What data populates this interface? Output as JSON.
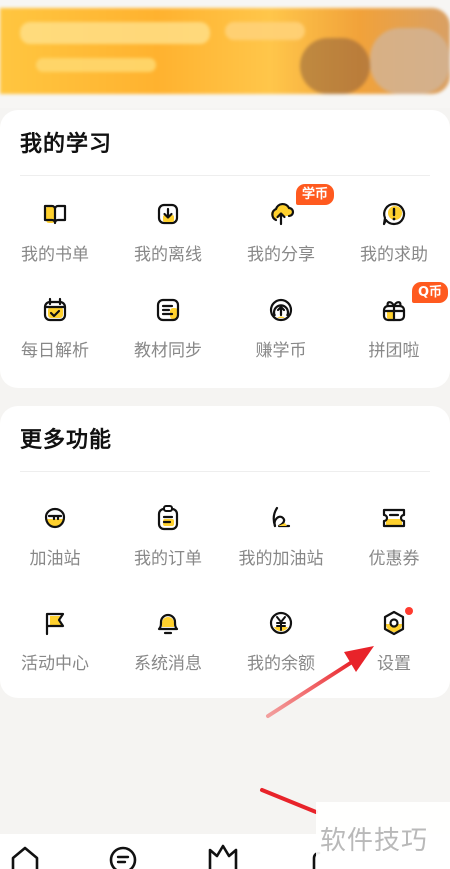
{
  "study": {
    "title": "我的学习",
    "items": [
      {
        "label": "我的书单"
      },
      {
        "label": "我的离线"
      },
      {
        "label": "我的分享",
        "badge": "学币"
      },
      {
        "label": "我的求助"
      },
      {
        "label": "每日解析"
      },
      {
        "label": "教材同步"
      },
      {
        "label": "赚学币"
      },
      {
        "label": "拼团啦",
        "badge": "Q币"
      }
    ]
  },
  "more": {
    "title": "更多功能",
    "items": [
      {
        "label": "加油站"
      },
      {
        "label": "我的订单"
      },
      {
        "label": "我的加油站"
      },
      {
        "label": "优惠券"
      },
      {
        "label": "活动中心"
      },
      {
        "label": "系统消息"
      },
      {
        "label": "我的余额"
      },
      {
        "label": "设置"
      }
    ]
  },
  "watermark": "软件技巧",
  "colors": {
    "accent": "#ffd12e",
    "badge": "#ff5a1f",
    "arrow": "#e8232a"
  }
}
